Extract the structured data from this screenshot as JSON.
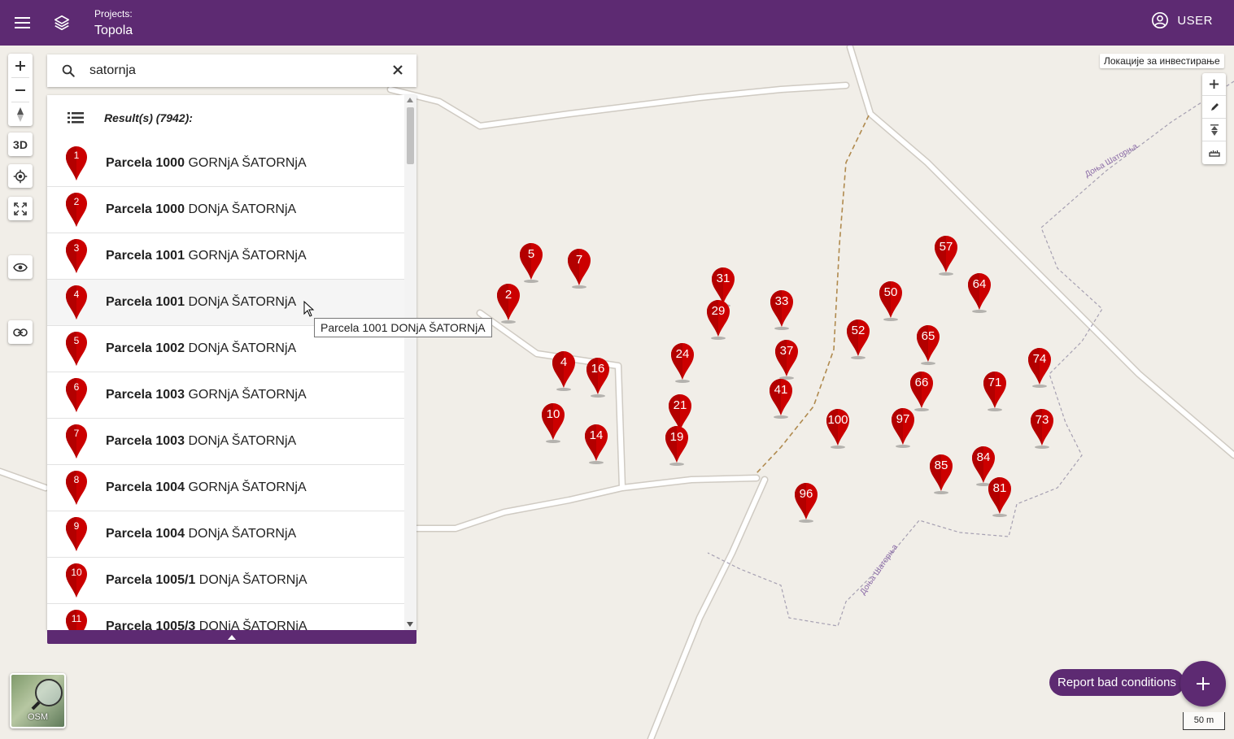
{
  "header": {
    "projects_label": "Projects:",
    "project_name": "Topola",
    "user_label": "USER"
  },
  "map_tools": {
    "view_3d_label": "3D"
  },
  "layer_label": "Локације за инвестирање",
  "search": {
    "value": "satornja"
  },
  "results": {
    "title": "Result(s) (7942):",
    "items": [
      {
        "num": "1",
        "parcel": "Parcela 1000",
        "place": "GORNjA ŠATORNjA"
      },
      {
        "num": "2",
        "parcel": "Parcela 1000",
        "place": "DONjA ŠATORNjA"
      },
      {
        "num": "3",
        "parcel": "Parcela 1001",
        "place": "GORNjA ŠATORNjA"
      },
      {
        "num": "4",
        "parcel": "Parcela 1001",
        "place": "DONjA ŠATORNjA"
      },
      {
        "num": "5",
        "parcel": "Parcela 1002",
        "place": "DONjA ŠATORNjA"
      },
      {
        "num": "6",
        "parcel": "Parcela 1003",
        "place": "GORNjA ŠATORNjA"
      },
      {
        "num": "7",
        "parcel": "Parcela 1003",
        "place": "DONjA ŠATORNjA"
      },
      {
        "num": "8",
        "parcel": "Parcela 1004",
        "place": "GORNjA ŠATORNjA"
      },
      {
        "num": "9",
        "parcel": "Parcela 1004",
        "place": "DONjA ŠATORNjA"
      },
      {
        "num": "10",
        "parcel": "Parcela 1005/1",
        "place": "DONjA ŠATORNjA"
      },
      {
        "num": "11",
        "parcel": "Parcela 1005/3",
        "place": "DONjA ŠATORNjA"
      }
    ]
  },
  "tooltip": "Parcela 1001 DONjA ŠATORNjA",
  "map_labels": {
    "road_1": "Доња Шаторња",
    "road_2": "Доња Шаторња"
  },
  "markers": [
    "5",
    "7",
    "2",
    "4",
    "16",
    "10",
    "14",
    "31",
    "29",
    "24",
    "21",
    "19",
    "33",
    "37",
    "41",
    "57",
    "50",
    "64",
    "52",
    "65",
    "66",
    "100",
    "97",
    "74",
    "71",
    "73",
    "85",
    "84",
    "81",
    "96"
  ],
  "basemap_label": "OSM",
  "report_button": "Report bad conditions",
  "scale_label": "50 m",
  "colors": {
    "brand": "#5d2a72",
    "marker": "#cc0000"
  }
}
